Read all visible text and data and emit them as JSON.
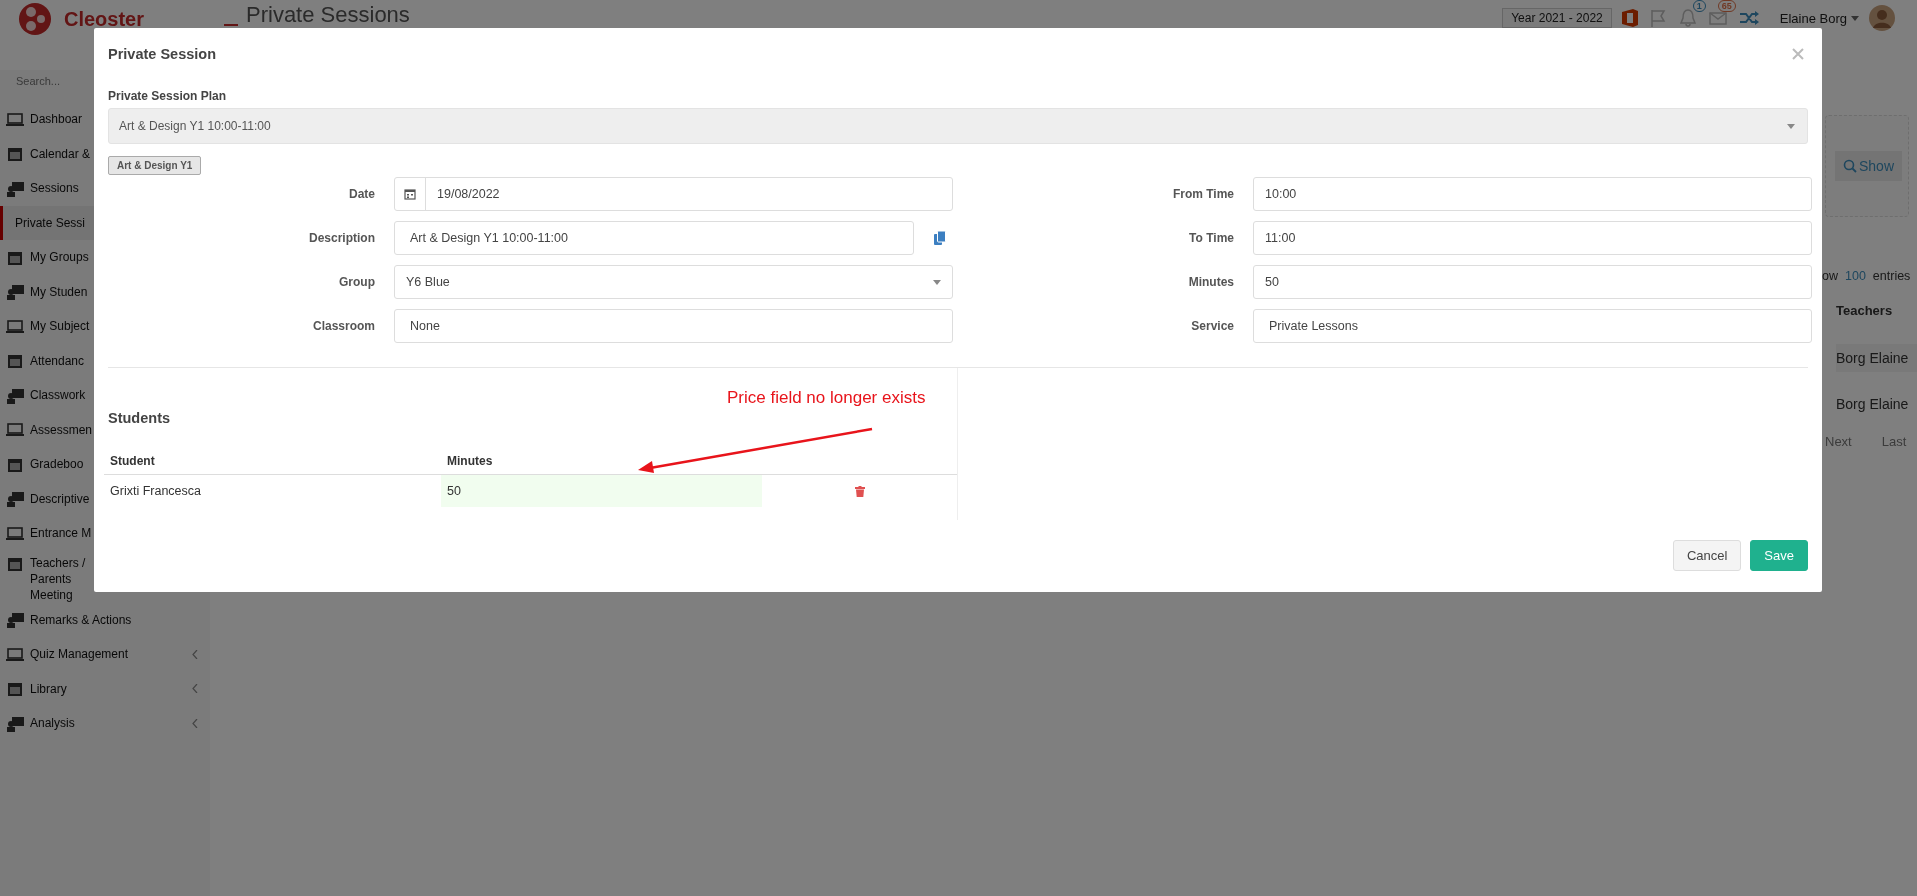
{
  "topbar": {
    "logo_text": "Cleoster",
    "page_title": "Private Sessions",
    "year_select": "Year 2021 - 2022",
    "notifications": [
      {
        "kind": "bell",
        "count": "1"
      },
      {
        "kind": "mail",
        "count": "65"
      }
    ],
    "user_name": "Elaine Borg"
  },
  "sidebar": {
    "search_placeholder": "Search...",
    "items": [
      {
        "label": "Dashboar",
        "selected": false,
        "submenu": false
      },
      {
        "label": "Calendar &",
        "selected": false,
        "submenu": false
      },
      {
        "label": "Sessions",
        "selected": false,
        "submenu": false
      },
      {
        "label": "Private Sessi",
        "selected": true,
        "submenu": false
      },
      {
        "label": "My Groups",
        "selected": false,
        "submenu": false
      },
      {
        "label": "My Studen",
        "selected": false,
        "submenu": false
      },
      {
        "label": "My Subject",
        "selected": false,
        "submenu": false
      },
      {
        "label": "Attendanc",
        "selected": false,
        "submenu": false
      },
      {
        "label": "Classwork",
        "selected": false,
        "submenu": false
      },
      {
        "label": "Assessmen",
        "selected": false,
        "submenu": false
      },
      {
        "label": "Gradeboo",
        "selected": false,
        "submenu": false
      },
      {
        "label": "Descriptive",
        "selected": false,
        "submenu": false
      },
      {
        "label": "Entrance M",
        "selected": false,
        "submenu": false
      },
      {
        "label": "Teachers / Parents Meeting",
        "selected": false,
        "submenu": false
      },
      {
        "label": "Remarks & Actions",
        "selected": false,
        "submenu": false
      },
      {
        "label": "Quiz Management",
        "selected": false,
        "submenu": true
      },
      {
        "label": "Library",
        "selected": false,
        "submenu": true
      },
      {
        "label": "Analysis",
        "selected": false,
        "submenu": true
      }
    ]
  },
  "background": {
    "show_button": "Show",
    "entries_prefix": "ow",
    "entries_count": "100",
    "entries_suffix": "entries",
    "column": "Teachers",
    "rows": [
      "Borg Elaine",
      "Borg Elaine"
    ],
    "pagination": [
      "Next",
      "Last"
    ]
  },
  "modal": {
    "title": "Private Session",
    "plan": {
      "label": "Private Session Plan",
      "value": "Art & Design Y1 10:00-11:00",
      "disabled": true
    },
    "plan_tag": "Art & Design Y1",
    "left_fields": [
      {
        "label": "Date",
        "value": "19/08/2022",
        "kind": "date"
      },
      {
        "label": "Description",
        "value": "Art & Design Y1 10:00-11:00",
        "kind": "copy"
      },
      {
        "label": "Group",
        "value": "Y6 Blue",
        "kind": "select"
      },
      {
        "label": "Classroom",
        "value": "None",
        "kind": "text"
      }
    ],
    "right_fields": [
      {
        "label": "From Time",
        "value": "10:00",
        "kind": "text"
      },
      {
        "label": "To Time",
        "value": "11:00",
        "kind": "text"
      },
      {
        "label": "Minutes",
        "value": "50",
        "kind": "text"
      },
      {
        "label": "Service",
        "value": "Private Lessons",
        "kind": "text"
      }
    ],
    "students": {
      "title": "Students",
      "columns": [
        "Student",
        "Minutes"
      ],
      "rows": [
        {
          "student": "Grixti Francesca",
          "minutes": "50"
        }
      ]
    },
    "buttons": [
      {
        "label": "Cancel",
        "kind": "default"
      },
      {
        "label": "Save",
        "kind": "primary"
      }
    ]
  },
  "annotation": {
    "text": "Price field no longer exists"
  }
}
